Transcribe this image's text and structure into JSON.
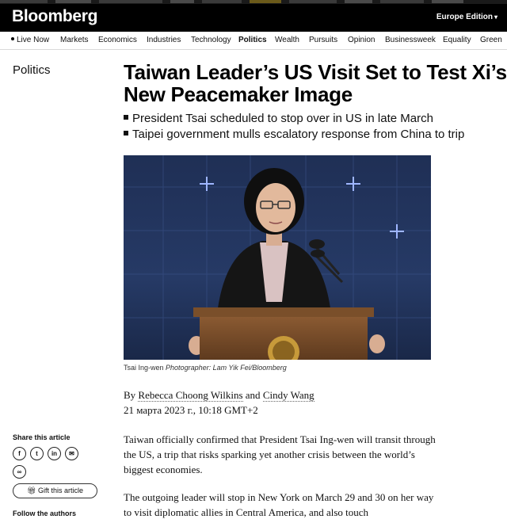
{
  "brand": {
    "logo": "Bloomberg",
    "edition": "Europe Edition",
    "edition_chevron_icon": "chevron-down-icon",
    "colors": {
      "top_bar": "#000000",
      "text_on_dark": "#ffffff"
    }
  },
  "nav": {
    "items": [
      {
        "label": "Live Now",
        "live_dot": true,
        "active": false
      },
      {
        "label": "Markets",
        "active": false
      },
      {
        "label": "Economics",
        "active": false
      },
      {
        "label": "Industries",
        "active": false
      },
      {
        "label": "Technology",
        "active": false
      },
      {
        "label": "Politics",
        "active": true
      },
      {
        "label": "Wealth",
        "active": false
      },
      {
        "label": "Pursuits",
        "active": false
      },
      {
        "label": "Opinion",
        "active": false
      },
      {
        "label": "Businessweek",
        "active": false
      },
      {
        "label": "Equality",
        "active": false
      },
      {
        "label": "Green",
        "active": false
      }
    ]
  },
  "article": {
    "section": "Politics",
    "headline": "Taiwan Leader’s US Visit Set to Test Xi’s New Peacemaker Image",
    "bullets": [
      "President Tsai scheduled to stop over in US in late March",
      "Taipei government mulls escalatory response from China to trip"
    ],
    "photo": {
      "subject": "Tsai Ing-wen",
      "credit": "Photographer: Lam Yik Fei/Bloomberg"
    },
    "byline": {
      "prefix": "By",
      "author_1": "Rebecca Choong Wilkins",
      "joiner": "and",
      "author_2": "Cindy Wang"
    },
    "date": "21 марта 2023 г., 10:18 GMT+2",
    "paragraphs": [
      "Taiwan officially confirmed that President Tsai Ing-wen will transit through the US, a trip that risks sparking yet another crisis between the world’s biggest economies.",
      "The outgoing leader will stop in New York on March 29 and 30 on her way to visit diplomatic allies in Central America, and also touch"
    ]
  },
  "sidebar": {
    "share_title": "Share this article",
    "share_buttons": [
      {
        "icon": "facebook-icon",
        "glyph": "f"
      },
      {
        "icon": "twitter-icon",
        "glyph": "t"
      },
      {
        "icon": "linkedin-icon",
        "glyph": "in"
      },
      {
        "icon": "email-icon",
        "glyph": "✉"
      },
      {
        "icon": "link-icon",
        "glyph": "∞"
      }
    ],
    "gift_label": "Gift this article",
    "gift_icon": "gift-icon",
    "follow_title": "Follow the authors"
  }
}
